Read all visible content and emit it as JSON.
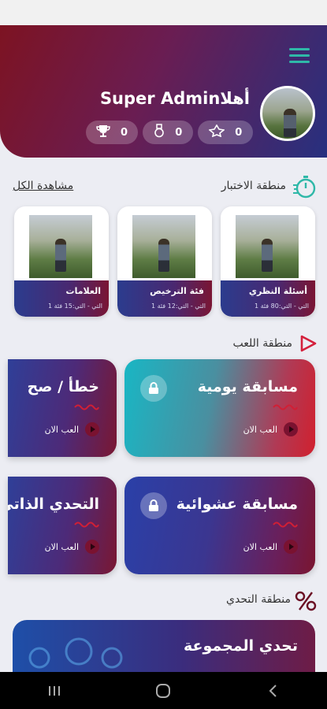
{
  "header": {
    "greeting": "أهلاSuper Admin",
    "stats": [
      {
        "icon": "badge-icon",
        "value": "0"
      },
      {
        "icon": "medal-icon",
        "value": "0"
      },
      {
        "icon": "trophy-icon",
        "value": "0"
      }
    ]
  },
  "test_area": {
    "title": "منطقة الاختبار",
    "view_all": "مشاهدة الكل",
    "cards": [
      {
        "title": "أسئلة النظري",
        "meta": "التي - التي:80   فئة 1"
      },
      {
        "title": "فئة الترخيص",
        "meta": "التي - التي:12   فئة 1"
      },
      {
        "title": "العلامات",
        "meta": "التي - التي:15   فئة 1"
      }
    ]
  },
  "play_area": {
    "title": "منطقة اللعب",
    "play_label": "العب الان",
    "games": [
      {
        "title": "مسابقة يومية"
      },
      {
        "title": "خطأ / صح"
      },
      {
        "title": "مسابقة عشوائية"
      },
      {
        "title": "التحدي الذاتي"
      }
    ]
  },
  "challenge_area": {
    "title": "منطقة التحدي",
    "group_challenge": "تحدي المجموعة"
  },
  "colors": {
    "accent_teal": "#2fb8a8",
    "brand_red": "#7d1322",
    "brand_blue": "#27307f"
  }
}
